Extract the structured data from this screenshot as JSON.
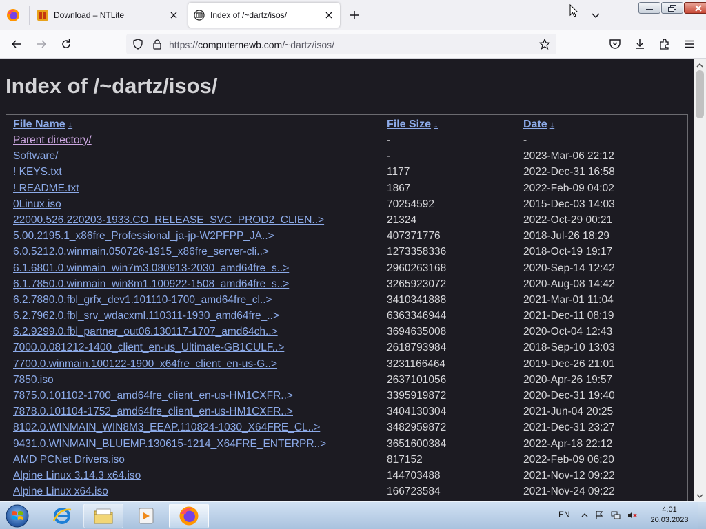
{
  "browser": {
    "tabs": [
      {
        "title": "Download – NTLite",
        "active": false
      },
      {
        "title": "Index of /~dartz/isos/",
        "active": true
      }
    ],
    "url": {
      "scheme": "https://",
      "host": "computernewb.com",
      "path": "/~dartz/isos/"
    }
  },
  "page": {
    "title": "Index of /~dartz/isos/",
    "columns": {
      "name": "File Name",
      "size": "File Size",
      "date": "Date",
      "sort_arrow": "↓"
    },
    "rows": [
      {
        "name": "Parent directory/",
        "size": "-",
        "date": "-"
      },
      {
        "name": "Software/",
        "size": "-",
        "date": "2023-Mar-06 22:12"
      },
      {
        "name": "! KEYS.txt",
        "size": "1177",
        "date": "2022-Dec-31 16:58"
      },
      {
        "name": "! README.txt",
        "size": "1867",
        "date": "2022-Feb-09 04:02"
      },
      {
        "name": "0Linux.iso",
        "size": "70254592",
        "date": "2015-Dec-03 14:03"
      },
      {
        "name": "22000.526.220203-1933.CO_RELEASE_SVC_PROD2_CLIEN..>",
        "size": "21324",
        "date": "2022-Oct-29 00:21"
      },
      {
        "name": "5.00.2195.1_x86fre_Professional_ja-jp-W2PFPP_JA..>",
        "size": "407371776",
        "date": "2018-Jul-26 18:29"
      },
      {
        "name": "6.0.5212.0.winmain.050726-1915_x86fre_server-cli..>",
        "size": "1273358336",
        "date": "2018-Oct-19 19:17"
      },
      {
        "name": "6.1.6801.0.winmain_win7m3.080913-2030_amd64fre_s..>",
        "size": "2960263168",
        "date": "2020-Sep-14 12:42"
      },
      {
        "name": "6.1.7850.0.winmain_win8m1.100922-1508_amd64fre_s..>",
        "size": "3265923072",
        "date": "2020-Aug-08 14:42"
      },
      {
        "name": "6.2.7880.0.fbl_grfx_dev1.101110-1700_amd64fre_cl..>",
        "size": "3410341888",
        "date": "2021-Mar-01 11:04"
      },
      {
        "name": "6.2.7962.0.fbl_srv_wdacxml.110311-1930_amd64fre_..>",
        "size": "6363346944",
        "date": "2021-Dec-11 08:19"
      },
      {
        "name": "6.2.9299.0.fbl_partner_out06.130117-1707_amd64ch..>",
        "size": "3694635008",
        "date": "2020-Oct-04 12:43"
      },
      {
        "name": "7000.0.081212-1400_client_en-us_Ultimate-GB1CULF..>",
        "size": "2618793984",
        "date": "2018-Sep-10 13:03"
      },
      {
        "name": "7700.0.winmain.100122-1900_x64fre_client_en-us-G..>",
        "size": "3231166464",
        "date": "2019-Dec-26 21:01"
      },
      {
        "name": "7850.iso",
        "size": "2637101056",
        "date": "2020-Apr-26 19:57"
      },
      {
        "name": "7875.0.101102-1700_amd64fre_client_en-us-HM1CXFR..>",
        "size": "3395919872",
        "date": "2020-Dec-31 19:40"
      },
      {
        "name": "7878.0.101104-1752_amd64fre_client_en-us-HM1CXFR..>",
        "size": "3404130304",
        "date": "2021-Jun-04 20:25"
      },
      {
        "name": "8102.0.WINMAIN_WIN8M3_EEAP.110824-1030_X64FRE_CL..>",
        "size": "3482959872",
        "date": "2021-Dec-31 23:27"
      },
      {
        "name": "9431.0.WINMAIN_BLUEMP.130615-1214_X64FRE_ENTERPR..>",
        "size": "3651600384",
        "date": "2022-Apr-18 22:12"
      },
      {
        "name": "AMD PCNet Drivers.iso",
        "size": "817152",
        "date": "2022-Feb-09 06:20"
      },
      {
        "name": "Alpine Linux 3.14.3 x64.iso",
        "size": "144703488",
        "date": "2021-Nov-12 09:22"
      },
      {
        "name": "Alpine Linux x64.iso",
        "size": "166723584",
        "date": "2021-Nov-24 09:22"
      }
    ]
  },
  "taskbar": {
    "language": "EN",
    "time": "4:01",
    "date": "20.03.2023"
  },
  "icons": {
    "tab_bar": [
      "firefox-icon",
      "ntlite-favicon",
      "site-favicon",
      "close-icon",
      "plus-icon",
      "chevron-down-icon"
    ],
    "nav_bar": [
      "back-arrow-icon",
      "forward-arrow-icon",
      "reload-icon",
      "shield-icon",
      "lock-icon",
      "star-icon",
      "pocket-icon",
      "download-icon",
      "extensions-icon",
      "menu-icon"
    ],
    "taskbar": [
      "windows-start-icon",
      "internet-explorer-icon",
      "file-explorer-icon",
      "media-player-icon",
      "firefox-icon",
      "flag-icon",
      "network-icon",
      "volume-muted-icon"
    ]
  },
  "colors": {
    "page_background": "#1c1b22",
    "link": "#8caae8",
    "visited_link": "#cba6e0",
    "text": "#d6d6d9"
  }
}
